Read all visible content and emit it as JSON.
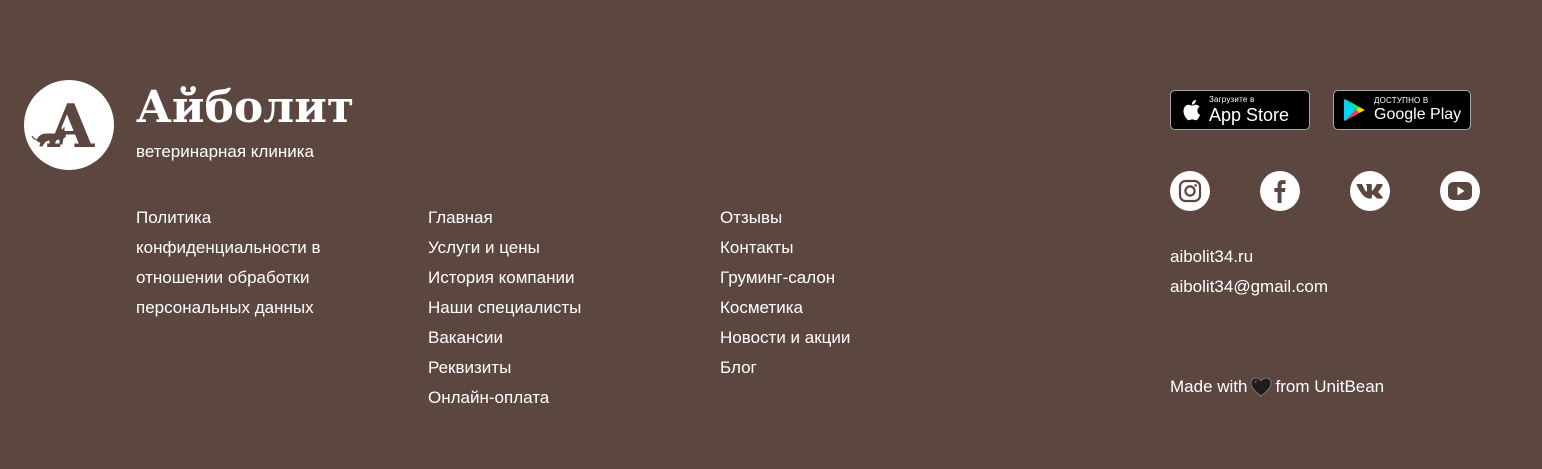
{
  "brand": {
    "logo_letter": "А",
    "name": "Айболит",
    "tagline": "ветеринарная клиника"
  },
  "nav": {
    "column1": [
      {
        "label": "Политика"
      },
      {
        "label": "конфиденциальности в"
      },
      {
        "label": "отношении обработки"
      },
      {
        "label": "персональных данных"
      }
    ],
    "column2": [
      {
        "label": "Главная"
      },
      {
        "label": "Услуги и цены"
      },
      {
        "label": "История компании"
      },
      {
        "label": "Наши специалисты"
      },
      {
        "label": "Вакансии"
      },
      {
        "label": "Реквизиты"
      },
      {
        "label": "Онлайн-оплата"
      }
    ],
    "column3": [
      {
        "label": "Отзывы"
      },
      {
        "label": "Контакты"
      },
      {
        "label": "Груминг-салон"
      },
      {
        "label": "Косметика"
      },
      {
        "label": "Новости и акции"
      },
      {
        "label": "Блог"
      }
    ]
  },
  "stores": {
    "appstore": {
      "small": "Загрузите в",
      "big": "App Store",
      "icon": "apple-icon"
    },
    "googleplay": {
      "small": "ДОСТУПНО В",
      "big": "Google Play",
      "icon": "google-play-icon"
    }
  },
  "social": [
    {
      "name": "instagram",
      "icon": "instagram-icon"
    },
    {
      "name": "facebook",
      "icon": "facebook-icon"
    },
    {
      "name": "vk",
      "icon": "vk-icon"
    },
    {
      "name": "youtube",
      "icon": "youtube-icon"
    }
  ],
  "contacts": {
    "website": "aibolit34.ru",
    "email": "aibolit34@gmail.com"
  },
  "credits": {
    "prefix": "Made with",
    "suffix": "from UnitBean",
    "icon": "heart-icon"
  },
  "colors": {
    "background": "#5c4640",
    "text": "#ffffff",
    "badge_background": "#000000"
  }
}
